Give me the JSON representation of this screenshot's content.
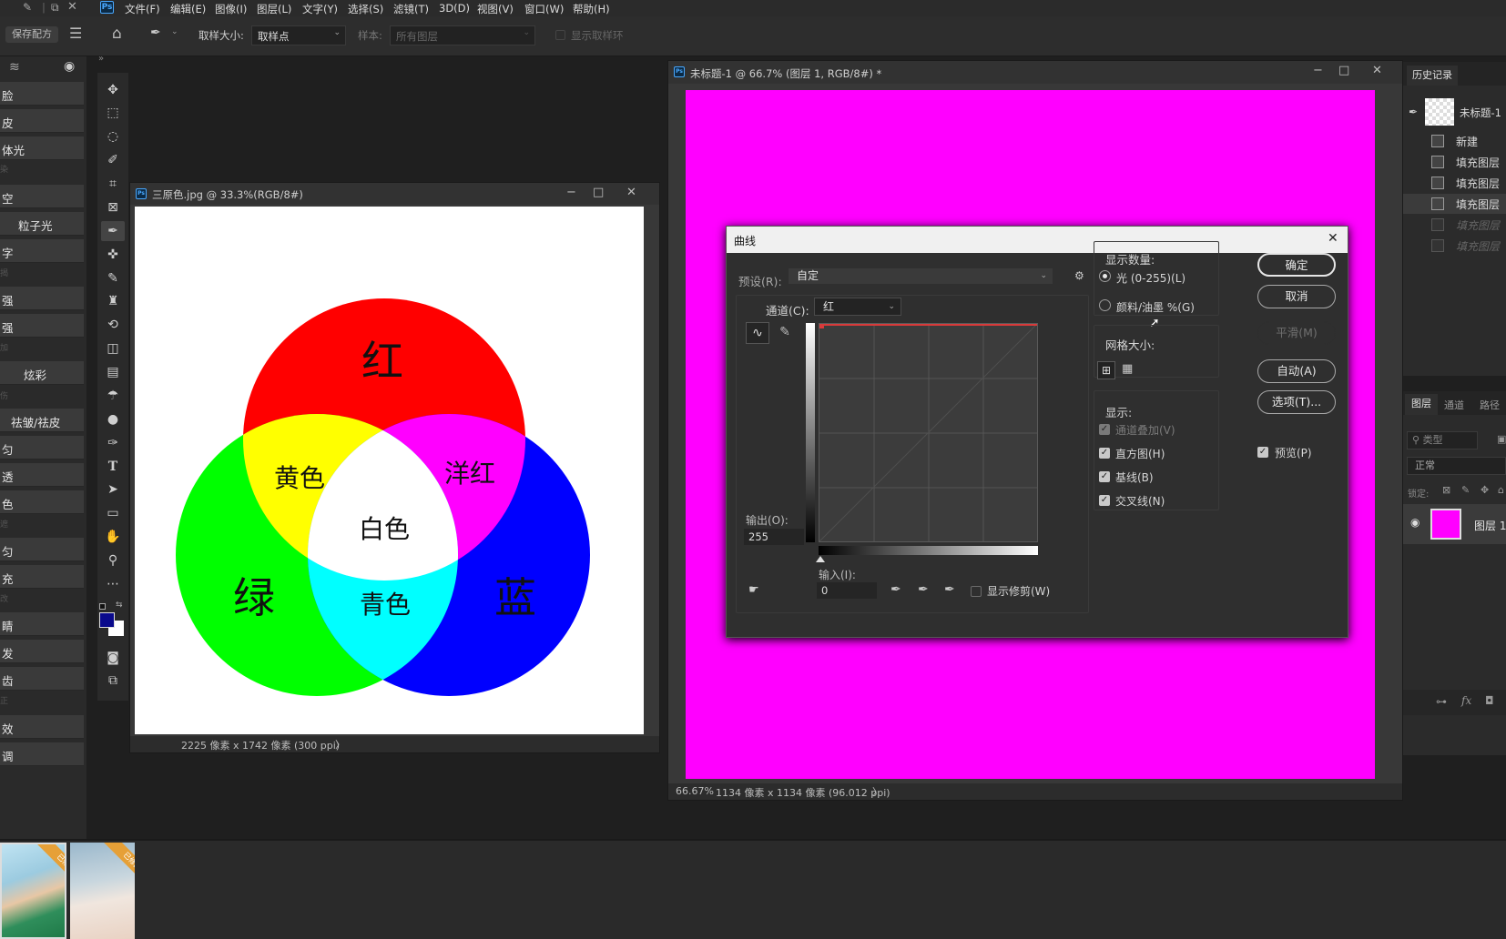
{
  "menubar": {
    "items": [
      "文件(F)",
      "编辑(E)",
      "图像(I)",
      "图层(L)",
      "文字(Y)",
      "选择(S)",
      "滤镜(T)",
      "3D(D)",
      "视图(V)",
      "窗口(W)",
      "帮助(H)"
    ],
    "logo": "Ps"
  },
  "options": {
    "sample_size_label": "取样大小:",
    "sample_size_value": "取样点",
    "sample_label": "样本:",
    "sample_value": "所有图层",
    "show_ring_label": "显示取样环"
  },
  "left_panel": {
    "save_recipe": "保存配方",
    "buttons": [
      "脸",
      "皮",
      "体光",
      "空",
      "粒子光",
      "字",
      "强",
      "强",
      "炫彩",
      "祛皱/祛皮",
      "匀",
      "透",
      "色",
      "匀",
      "充",
      "睛",
      "发",
      "齿",
      "效",
      "调"
    ],
    "mini_labels": [
      "染",
      "揭",
      "加",
      "伤",
      "遮",
      "改",
      "正"
    ]
  },
  "doc1": {
    "title": "三原色.jpg @ 33.3%(RGB/8#)",
    "status": "2225 像素 x 1742 像素 (300 ppi)",
    "status_arrow": "〉",
    "labels": {
      "red": "红",
      "yellow": "黄色",
      "magenta": "洋红",
      "white": "白色",
      "green": "绿",
      "cyan": "青色",
      "blue": "蓝"
    }
  },
  "doc2": {
    "title": "未标题-1 @ 66.7% (图层 1, RGB/8#) *",
    "zoom": "66.67%",
    "status": "1134 像素 x 1134 像素 (96.012 ppi)",
    "status_arrow": "〉",
    "canvas_color": "#ff00ff"
  },
  "curves": {
    "title": "曲线",
    "preset_label": "预设(R):",
    "preset_value": "自定",
    "channel_label": "通道(C):",
    "channel_value": "红",
    "output_label": "输出(O):",
    "output_value": "255",
    "input_label": "输入(I):",
    "input_value": "0",
    "show_clipping": "显示修剪(W)",
    "show_amount_label": "显示数量:",
    "light_option": "光 (0-255)(L)",
    "pigment_option": "颜料/油墨 %(G)",
    "grid_size_label": "网格大小:",
    "show_label": "显示:",
    "show_items": [
      "通道叠加(V)",
      "直方图(H)",
      "基线(B)",
      "交叉线(N)"
    ],
    "buttons": {
      "ok": "确定",
      "cancel": "取消",
      "smooth": "平滑(M)",
      "auto": "自动(A)",
      "options": "选项(T)..."
    },
    "preview": "预览(P)"
  },
  "history": {
    "tab": "历史记录",
    "snapshot": "未标题-1",
    "items": [
      "新建",
      "填充图层",
      "填充图层",
      "填充图层",
      "填充图层",
      "填充图层"
    ]
  },
  "layers": {
    "tabs": [
      "图层",
      "通道",
      "路径"
    ],
    "filter": "类型",
    "blend": "正常",
    "lock_label": "锁定:",
    "layer_name": "图层 1",
    "layer_color": "#ff00ff",
    "fx": "fx"
  },
  "thumbs": {
    "badge": "已修图"
  }
}
